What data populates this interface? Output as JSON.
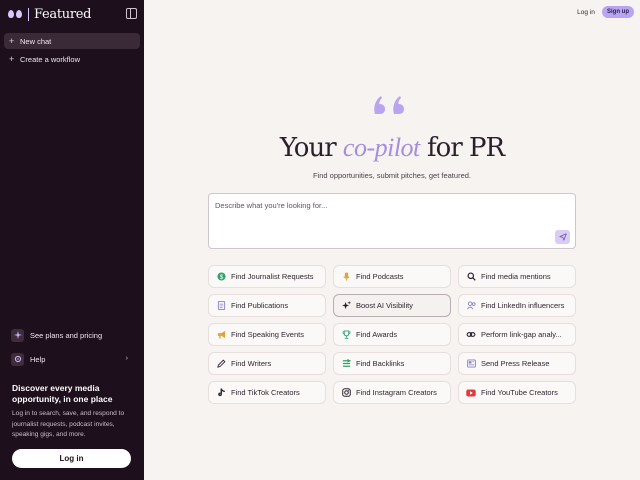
{
  "brand": {
    "name": "Featured"
  },
  "sidebar": {
    "items": [
      {
        "label": "New chat",
        "icon": "plus-icon"
      },
      {
        "label": "Create a workflow",
        "icon": "plus-icon"
      }
    ],
    "lower": [
      {
        "label": "See plans and pricing",
        "icon": "sparkle-icon"
      },
      {
        "label": "Help",
        "icon": "gear-icon"
      }
    ],
    "promo": {
      "title": "Discover every media opportunity, in one place",
      "text": "Log in to search, save, and respond to journalist requests, podcast invites, speaking gigs, and more.",
      "login_label": "Log in"
    }
  },
  "header": {
    "login_label": "Log in",
    "signup_label": "Sign up"
  },
  "hero": {
    "title_before": "Your",
    "title_accent": "co-pilot",
    "title_after": "for PR",
    "subtitle": "Find opportunities, submit pitches, get featured."
  },
  "search": {
    "placeholder": "Describe what you're looking for..."
  },
  "chips": [
    {
      "label": "Find Journalist Requests",
      "icon": "dollar-icon",
      "color": "#2fa36b"
    },
    {
      "label": "Find Podcasts",
      "icon": "mic-icon",
      "color": "#e0a23a"
    },
    {
      "label": "Find media mentions",
      "icon": "search-icon",
      "color": "#2a1f2b"
    },
    {
      "label": "Find Publications",
      "icon": "document-icon",
      "color": "#8a7bc8"
    },
    {
      "label": "Boost AI Visibility",
      "icon": "sparkle-icon",
      "color": "#2a1f2b"
    },
    {
      "label": "Find LinkedIn influencers",
      "icon": "users-icon",
      "color": "#8a7bc8"
    },
    {
      "label": "Find Speaking Events",
      "icon": "megaphone-icon",
      "color": "#e0a23a"
    },
    {
      "label": "Find Awards",
      "icon": "trophy-icon",
      "color": "#2fa36b"
    },
    {
      "label": "Perform link-gap analy...",
      "icon": "link-icon",
      "color": "#2a1f2b"
    },
    {
      "label": "Find Writers",
      "icon": "pencil-icon",
      "color": "#2a1f2b"
    },
    {
      "label": "Find Backlinks",
      "icon": "backlink-icon",
      "color": "#2fa36b"
    },
    {
      "label": "Send Press Release",
      "icon": "newspaper-icon",
      "color": "#8a7bc8"
    },
    {
      "label": "Find TikTok Creators",
      "icon": "tiktok-icon",
      "color": "#2a1f2b"
    },
    {
      "label": "Find Instagram Creators",
      "icon": "instagram-icon",
      "color": "#2a1f2b"
    },
    {
      "label": "Find YouTube Creators",
      "icon": "youtube-icon",
      "color": "#e03a3a"
    }
  ]
}
